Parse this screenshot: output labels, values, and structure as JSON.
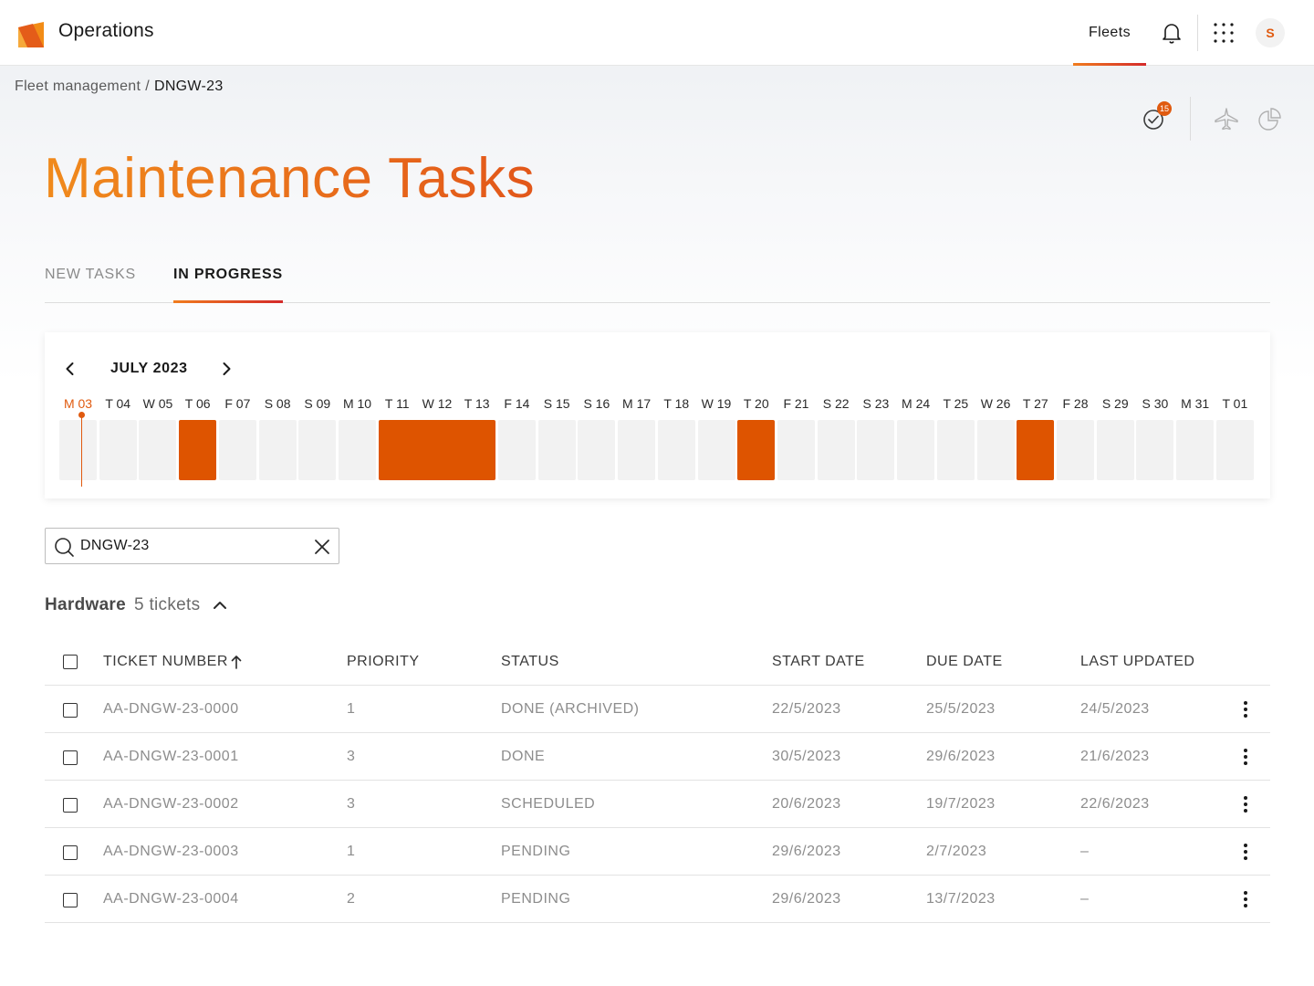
{
  "app": {
    "title": "Operations",
    "logo_icon": "operations-logo"
  },
  "topnav": {
    "fleets_label": "Fleets",
    "avatar_initial": "S"
  },
  "breadcrumb": {
    "parent": "Fleet management",
    "separator": "/",
    "current": "DNGW-23"
  },
  "tools": {
    "tasks_badge": "15"
  },
  "page": {
    "title": "Maintenance Tasks"
  },
  "tabs": [
    {
      "label": "NEW TASKS",
      "active": false
    },
    {
      "label": "IN PROGRESS",
      "active": true
    }
  ],
  "calendar": {
    "month_label": "JULY 2023",
    "today_index": 0,
    "days": [
      "M 03",
      "T 04",
      "W 05",
      "T 06",
      "F 07",
      "S 08",
      "S 09",
      "M 10",
      "T 11",
      "W 12",
      "T 13",
      "F 14",
      "S 15",
      "S 16",
      "M 17",
      "T 18",
      "W 19",
      "T 20",
      "F 21",
      "S 22",
      "S 23",
      "M 24",
      "T 25",
      "W 26",
      "T 27",
      "F 28",
      "S 29",
      "S 30",
      "M 31",
      "T 01"
    ],
    "tasks": [
      {
        "start_day": "T 06",
        "end_day": "T 06"
      },
      {
        "start_day": "T 11",
        "end_day": "T 13"
      },
      {
        "start_day": "T 20",
        "end_day": "T 20"
      },
      {
        "start_day": "T 27",
        "end_day": "T 27"
      }
    ],
    "task_color": "#de5400"
  },
  "search": {
    "value": "DNGW-23"
  },
  "section": {
    "name": "Hardware",
    "count_label": "5 tickets"
  },
  "table": {
    "headers": {
      "ticket": "TICKET NUMBER",
      "priority": "PRIORITY",
      "status": "STATUS",
      "start": "START DATE",
      "due": "DUE DATE",
      "updated": "LAST UPDATED"
    },
    "rows": [
      {
        "ticket": "AA-DNGW-23-0000",
        "priority": "1",
        "status": "DONE (ARCHIVED)",
        "start": "22/5/2023",
        "due": "25/5/2023",
        "updated": "24/5/2023"
      },
      {
        "ticket": "AA-DNGW-23-0001",
        "priority": "3",
        "status": "DONE",
        "start": "30/5/2023",
        "due": "29/6/2023",
        "updated": "21/6/2023"
      },
      {
        "ticket": "AA-DNGW-23-0002",
        "priority": "3",
        "status": "SCHEDULED",
        "start": "20/6/2023",
        "due": "19/7/2023",
        "updated": "22/6/2023"
      },
      {
        "ticket": "AA-DNGW-23-0003",
        "priority": "1",
        "status": "PENDING",
        "start": "29/6/2023",
        "due": "2/7/2023",
        "updated": "–"
      },
      {
        "ticket": "AA-DNGW-23-0004",
        "priority": "2",
        "status": "PENDING",
        "start": "29/6/2023",
        "due": "13/7/2023",
        "updated": "–"
      }
    ]
  },
  "colors": {
    "accent": "#e05a0f",
    "accent_gradient_start": "#f07c1e",
    "accent_gradient_end": "#d42a2a"
  }
}
